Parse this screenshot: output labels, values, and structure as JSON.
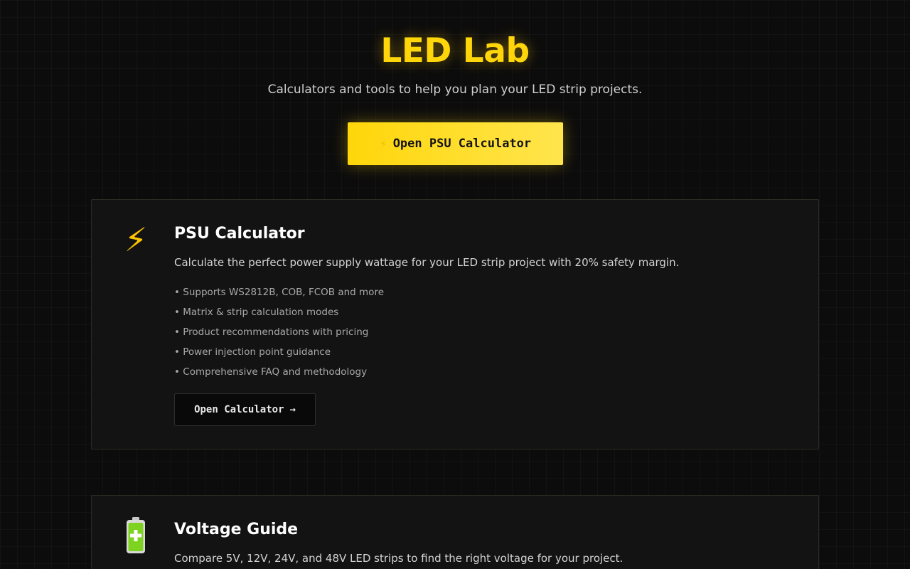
{
  "hero": {
    "title": "LED Lab",
    "subtitle": "Calculators and tools to help you plan your LED strip projects.",
    "cta": {
      "icon": "⚡",
      "label": "Open PSU Calculator"
    }
  },
  "cards": [
    {
      "icon": "⚡",
      "icon_name": "lightning-bolt-icon",
      "title": "PSU Calculator",
      "description": "Calculate the perfect power supply wattage for your LED strip project with 20% safety margin.",
      "features": [
        "Supports WS2812B, COB, FCOB and more",
        "Matrix & strip calculation modes",
        "Product recommendations with pricing",
        "Power injection point guidance",
        "Comprehensive FAQ and methodology"
      ],
      "button": {
        "label": "Open Calculator",
        "arrow": "→"
      }
    },
    {
      "icon_name": "battery-icon",
      "title": "Voltage Guide",
      "description": "Compare 5V, 12V, 24V, and 48V LED strips to find the right voltage for your project."
    }
  ],
  "colors": {
    "accent": "#ffd60a",
    "background": "#0c0c0c",
    "card": "#131313",
    "battery": "#7ed321"
  }
}
